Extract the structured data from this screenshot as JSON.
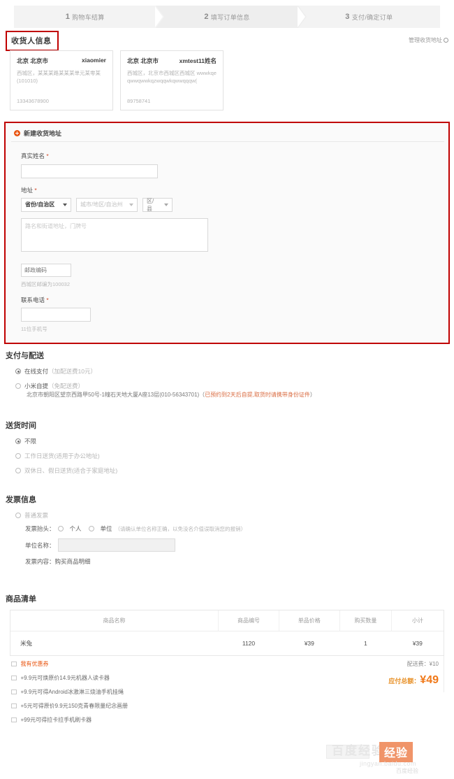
{
  "steps": [
    {
      "num": "1",
      "label": "购物车结算"
    },
    {
      "num": "2",
      "label": "填写订单信息"
    },
    {
      "num": "3",
      "label": "支付/确定订单"
    }
  ],
  "recipient": {
    "title": "收货人信息",
    "manage_link": "管理收货地址",
    "cards": [
      {
        "region": "北京 北京市",
        "name": "xiaomier",
        "detail": "西城区，某某某路某某某单元某零某 (101010)",
        "phone": "13343678900"
      },
      {
        "region": "北京 北京市",
        "name": "xmtest11姓名",
        "detail": "西城区，北京市西城区西城区 wwwkqeqwwqwwkqzwqqwkqwwqqqw(",
        "phone": "89758741"
      }
    ]
  },
  "new_address": {
    "heading": "新建收货地址",
    "name_label": "真实姓名",
    "name_value": "",
    "name_placeholder": "",
    "address_label": "地址",
    "province_select": "省份/自治区",
    "city_select": "城市/地区/自治州",
    "district_select": "区/县",
    "street_placeholder": "路名和街道地址，门牌号",
    "street_value": "",
    "zip_placeholder": "邮政编码",
    "zip_value": "",
    "zip_hint": "西城区邮编为100032",
    "phone_label": "联系电话",
    "phone_value": "",
    "phone_hint": "11位手机号",
    "required_mark": "*"
  },
  "payment": {
    "title": "支付与配送",
    "options": [
      {
        "label": "在线支付",
        "note": "（加配送费10元）",
        "selected": true
      },
      {
        "label": "小米自提",
        "note": "（免配送费）",
        "selected": false
      }
    ],
    "pickup_address": "北京市朝阳区望京西路甲50号-1幢石天地大厦A座13层(010-56343701)（",
    "pickup_warning": "已预约到2天后自提,取货时请携带身份证件",
    "pickup_close": "）"
  },
  "delivery": {
    "title": "送货时间",
    "options": [
      {
        "label": "不限",
        "note": "",
        "selected": true
      },
      {
        "label": "工作日送货",
        "note": "(适用于办公地址)",
        "selected": false
      },
      {
        "label": "双休日、假日送货",
        "note": "(适合于家庭地址)",
        "selected": false
      }
    ]
  },
  "invoice": {
    "title": "发票信息",
    "type_label": "普通发票",
    "header_label": "发票抬头：",
    "personal": "个人",
    "company": "单位",
    "company_note": "（请确认单位名称正确，以免没名介值误取消您的报销）",
    "company_name_label": "单位名称：",
    "company_name_value": "",
    "content_label": "发票内容：购买商品明细"
  },
  "goods": {
    "title": "商品清单",
    "columns": [
      "商品名称",
      "商品编号",
      "单品价格",
      "购买数量",
      "小计"
    ],
    "rows": [
      {
        "name": "米兔",
        "code": "1120",
        "price": "¥39",
        "qty": "1",
        "subtotal": "¥39"
      }
    ]
  },
  "coupons": {
    "items": [
      "我有优惠券",
      "+9.9元可焕原价14.9元机器人读卡器",
      "+9.9元可得Android冰激淋三烧油手机挂绳",
      "+5元可得原价9.9元150克青春限量纪念画册",
      "+99元可得拉卡拉手机刷卡器"
    ]
  },
  "totals": {
    "shipping_label": "配送费：",
    "shipping_value": "¥10",
    "grand_label": "应付总额：",
    "grand_value": "¥49"
  },
  "watermark": {
    "pale": "百度经验",
    "main": "经验",
    "sub": "jingyan.baidu.com",
    "sub2": "百度经验"
  },
  "colors": {
    "annotation": "#c00000",
    "accent": "#e8540f",
    "price": "#f07818"
  }
}
